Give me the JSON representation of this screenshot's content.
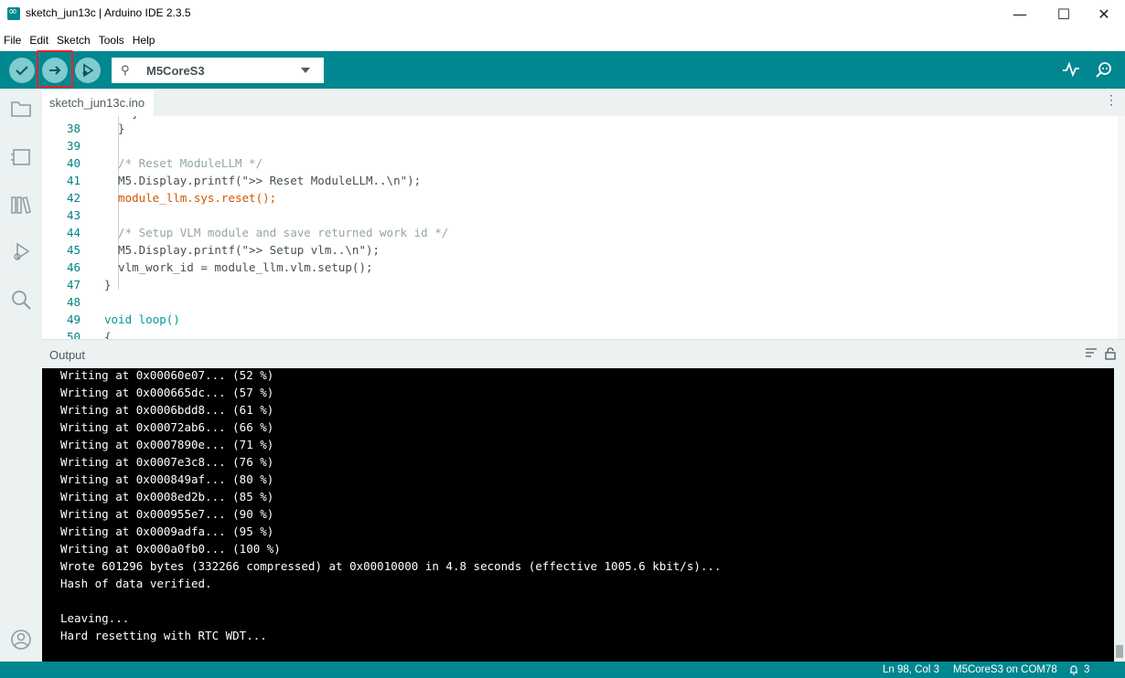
{
  "window": {
    "title": "sketch_jun13c | Arduino IDE 2.3.5",
    "minimize": "—",
    "maximize": "☐",
    "close": "✕"
  },
  "menu": [
    "File",
    "Edit",
    "Sketch",
    "Tools",
    "Help"
  ],
  "toolbar": {
    "verify_icon": "check-icon",
    "upload_icon": "arrow-right-icon",
    "debug_icon": "debug-icon",
    "board": "M5CoreS3",
    "serial_plotter_icon": "serial-plotter-icon",
    "serial_monitor_icon": "serial-monitor-icon",
    "accent": "#00878f",
    "highlight_color": "#e3262a"
  },
  "sidebar": [
    "folder-icon",
    "board-manager-icon",
    "library-icon",
    "debug-icon",
    "search-icon",
    "account-icon"
  ],
  "tabs": [
    {
      "label": "sketch_jun13c.ino"
    }
  ],
  "tab_more": "⋮",
  "editor": {
    "lines": [
      {
        "n": "38",
        "code": "  }"
      },
      {
        "n": "39",
        "code": ""
      },
      {
        "n": "40",
        "code": "  /* Reset ModuleLLM */"
      },
      {
        "n": "41",
        "code": "  M5.Display.printf(\">> Reset ModuleLLM..\\n\");"
      },
      {
        "n": "42",
        "code": "  module_llm.sys.reset();"
      },
      {
        "n": "43",
        "code": ""
      },
      {
        "n": "44",
        "code": "  /* Setup VLM module and save returned work id */"
      },
      {
        "n": "45",
        "code": "  M5.Display.printf(\">> Setup vlm..\\n\");"
      },
      {
        "n": "46",
        "code": "  vlm_work_id = module_llm.vlm.setup();"
      },
      {
        "n": "47",
        "code": "}"
      },
      {
        "n": "48",
        "code": ""
      },
      {
        "n": "49",
        "code": "void loop()"
      },
      {
        "n": "50",
        "code": "{"
      }
    ]
  },
  "output": {
    "title": "Output",
    "lines": [
      "Writing at 0x00060e07... (52 %)",
      "Writing at 0x000665dc... (57 %)",
      "Writing at 0x0006bdd8... (61 %)",
      "Writing at 0x00072ab6... (66 %)",
      "Writing at 0x0007890e... (71 %)",
      "Writing at 0x0007e3c8... (76 %)",
      "Writing at 0x000849af... (80 %)",
      "Writing at 0x0008ed2b... (85 %)",
      "Writing at 0x000955e7... (90 %)",
      "Writing at 0x0009adfa... (95 %)",
      "Writing at 0x000a0fb0... (100 %)",
      "Wrote 601296 bytes (332266 compressed) at 0x00010000 in 4.8 seconds (effective 1005.6 kbit/s)...",
      "Hash of data verified.",
      "",
      "Leaving...",
      "Hard resetting with RTC WDT..."
    ]
  },
  "status": {
    "position": "Ln 98, Col 3",
    "board_port": "M5CoreS3 on COM78",
    "notifications": "3"
  }
}
